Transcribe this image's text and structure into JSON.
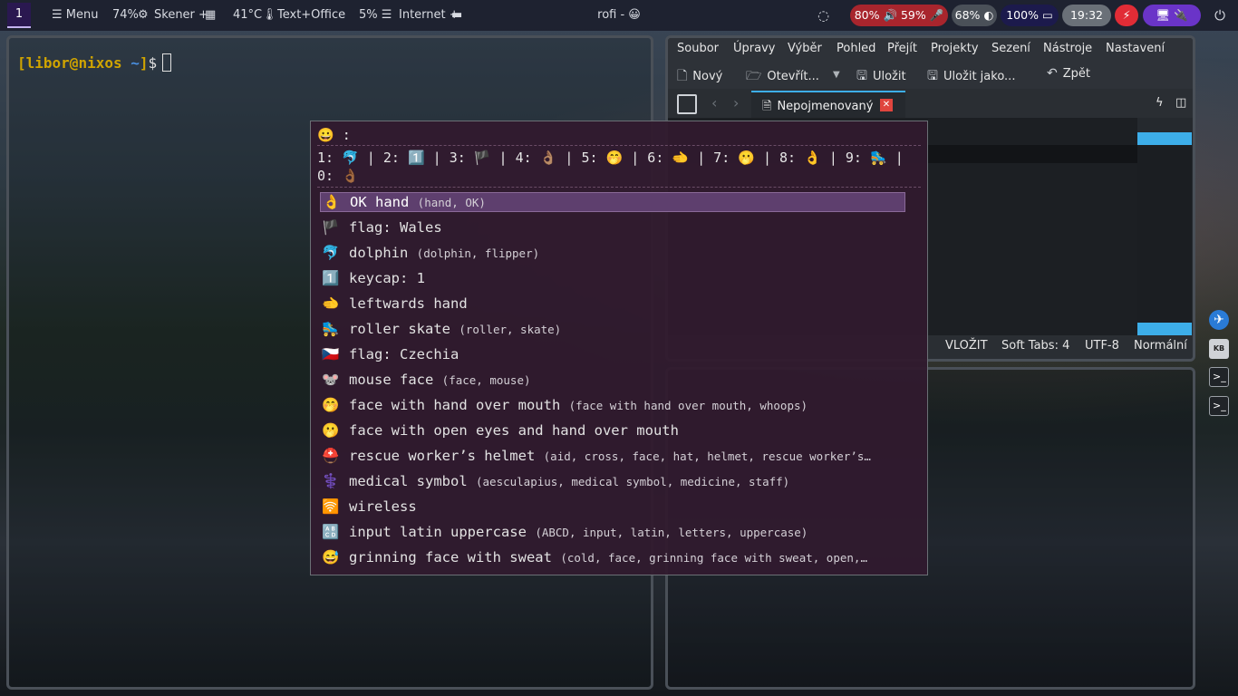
{
  "topbar": {
    "workspace": "1",
    "menu": "☰ Menu",
    "cpu": "74%",
    "scanner": "Skener +",
    "temp": "41°C",
    "text_office": "Text+Office",
    "disk": "5% ☰",
    "internet": "Internet +",
    "window_title": "rofi - 😀",
    "audio": "80% 🔊 59% 🎤",
    "brightness": "68% ◐",
    "battery": "100% ▭",
    "clock": "19:32",
    "power_profile_icon": "⚡",
    "system_icons": "🖥 🔌",
    "power_icon": "⏻"
  },
  "terminal": {
    "prompt_open": "[",
    "user_host": "libor@nixos",
    "path": " ~",
    "prompt_close": "]",
    "dollar": "$"
  },
  "editor": {
    "menu": [
      "Soubor",
      "Úpravy",
      "Výběr",
      "Pohled",
      "Přejít",
      "Projekty",
      "Sezení",
      "Nástroje",
      "Nastavení"
    ],
    "toolbar": {
      "new": "Nový",
      "open": "Otevřít...",
      "save": "Uložit",
      "save_as": "Uložit jako...",
      "undo": "Zpět"
    },
    "tab_title": "Nepojmenovaný",
    "status": {
      "mode": "VLOŽIT",
      "tabs": "Soft Tabs: 4",
      "encoding": "UTF-8",
      "view": "Normální"
    }
  },
  "rofi": {
    "prompt": "😀 :",
    "recent": "1: 🐬 | 2: 1️⃣ | 3: 🏴 | 4: 👌🏽 | 5: 🤭 | 6: 🫲 | 7: 🫢 | 8: 👌 | 9: 🛼 | 0: 👌🏾",
    "items": [
      {
        "emoji": "👌",
        "name": "OK hand",
        "keywords": "(hand, OK)"
      },
      {
        "emoji": "🏴",
        "name": "flag: Wales",
        "keywords": ""
      },
      {
        "emoji": "🐬",
        "name": "dolphin",
        "keywords": "(dolphin, flipper)"
      },
      {
        "emoji": "1️⃣",
        "name": "keycap: 1",
        "keywords": ""
      },
      {
        "emoji": "🫲",
        "name": "leftwards hand",
        "keywords": ""
      },
      {
        "emoji": "🛼",
        "name": "roller skate",
        "keywords": "(roller, skate)"
      },
      {
        "emoji": "🇨🇿",
        "name": "flag: Czechia",
        "keywords": ""
      },
      {
        "emoji": "🐭",
        "name": "mouse face",
        "keywords": "(face, mouse)"
      },
      {
        "emoji": "🤭",
        "name": "face with hand over mouth",
        "keywords": "(face with hand over mouth, whoops)"
      },
      {
        "emoji": "🫢",
        "name": "face with open eyes and hand over mouth",
        "keywords": ""
      },
      {
        "emoji": "⛑️",
        "name": "rescue worker’s helmet",
        "keywords": "(aid, cross, face, hat, helmet, rescue worker’s…"
      },
      {
        "emoji": "⚕️",
        "name": "medical symbol",
        "keywords": "(aesculapius, medical symbol, medicine, staff)"
      },
      {
        "emoji": "🛜",
        "name": "wireless",
        "keywords": ""
      },
      {
        "emoji": "🔠",
        "name": "input latin uppercase",
        "keywords": "(ABCD, input, latin, letters, uppercase)"
      },
      {
        "emoji": "😅",
        "name": "grinning face with sweat",
        "keywords": "(cold, face, grinning face with sweat, open,…"
      }
    ]
  }
}
